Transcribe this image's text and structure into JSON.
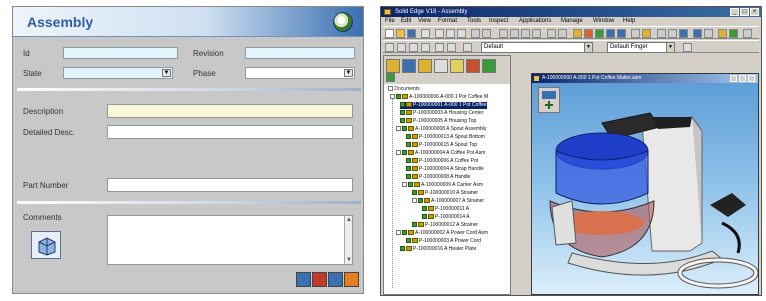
{
  "form": {
    "title": "Assembly",
    "labels": {
      "id": "Id",
      "revision": "Revision",
      "state": "State",
      "phase": "Phase",
      "description": "Description",
      "detailed_desc": "Detailed Desc.",
      "part_number": "Part Number",
      "comments": "Comments"
    },
    "values": {
      "id": "",
      "revision": "",
      "state": "",
      "phase": "",
      "description": "",
      "detailed_desc": "",
      "part_number": "",
      "comments": ""
    },
    "colors": {
      "title": "#2f5da8",
      "field_fill": "#e2f5fa",
      "description_fill": "#fbf8d8",
      "background": "#c8c8c8"
    },
    "bottom_buttons": [
      {
        "icon": "view-icon",
        "color": "#3a6fb0"
      },
      {
        "icon": "save-icon",
        "color": "#c0392b"
      },
      {
        "icon": "help-icon",
        "color": "#3a6fb0"
      },
      {
        "icon": "close-icon",
        "color": "#e67e22"
      }
    ]
  },
  "solid_edge": {
    "window_title": "Solid Edge V18 - Assembly",
    "menu": [
      "File",
      "Edit",
      "View",
      "Format",
      "Tools",
      "Inspect",
      "Applications",
      "Manage",
      "Window",
      "Help"
    ],
    "combo_left": "Default",
    "combo_right": "Default Finger",
    "document_title": "A-100000000 A-000 1 Pot Coffee Maker.asm",
    "tree": {
      "root": "Documents",
      "items": [
        "A-100000006 A-000 1 Pot Coffee M",
        "P-100000001 A-000 1 Pot Coffee",
        "P-100000003 A Housing Center",
        "P-100000005 A Housing Top",
        "A-100000008 A Spout Assembly",
        "P-100000013 A Spout Bottom",
        "P-100000015 A Spout Top",
        "A-100000004 A Coffee Pot Asm",
        "P-100000006 A Coffee Pot",
        "P-100000004 A Strap Handle",
        "P-100000008 A Handle",
        "A-100000009 A Carrier Asm",
        "P-100000010 A Strainer",
        "A-100000007 A Strainer",
        "P-100000011 A",
        "P-100000014 A",
        "P-100000012 A Strainer",
        "A-100000002 A Power Cord Asm",
        "P-100000003 A Power Cord",
        "P-100000016 A Heater Plate"
      ]
    }
  }
}
